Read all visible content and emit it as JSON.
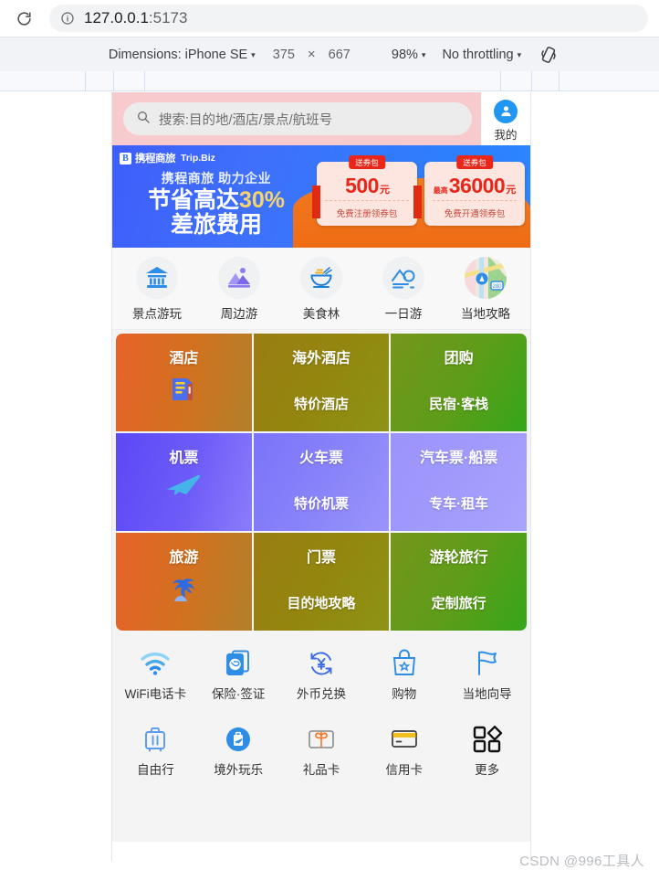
{
  "browser": {
    "reload_icon": "reload-icon",
    "info_icon": "info-icon",
    "url_host": "127.0.0.1",
    "url_port": ":5173"
  },
  "device_toolbar": {
    "dimensions_label": "Dimensions: iPhone SE",
    "width": "375",
    "times": "×",
    "height": "667",
    "zoom": "98%",
    "throttling": "No throttling",
    "rotate_icon": "rotate-device-icon",
    "caret": "▾"
  },
  "app": {
    "search": {
      "icon": "search-icon",
      "placeholder": "搜索:目的地/酒店/景点/航班号"
    },
    "mine": {
      "icon": "user-avatar-icon",
      "label": "我的"
    },
    "banner": {
      "logo_mark": "B",
      "logo_cn": "携程商旅",
      "logo_en": "Trip.Biz",
      "subtitle": "携程商旅 助力企业",
      "line1_a": "节省高达",
      "line1_b": "30%",
      "line2": "差旅费用",
      "coupons": [
        {
          "badge": "送券包",
          "prefix": "",
          "amount": "500",
          "unit": "元",
          "note": "免费注册领券包"
        },
        {
          "badge": "送券包",
          "prefix": "最高",
          "amount": "36000",
          "unit": "元",
          "note": "免费开通领券包"
        }
      ]
    },
    "quick_items": [
      {
        "icon": "temple-icon",
        "label": "景点游玩"
      },
      {
        "icon": "mountain-icon",
        "label": "周边游"
      },
      {
        "icon": "noodle-bowl-icon",
        "label": "美食林"
      },
      {
        "icon": "landscape-icon",
        "label": "一日游"
      },
      {
        "icon": "map-navigation-icon",
        "label": "当地攻略"
      }
    ],
    "grid": [
      {
        "main": "酒店",
        "sub": "",
        "icon": "hotel-building-icon",
        "color_from": "#e8622a",
        "color_to": "#b2802b"
      },
      {
        "main": "海外酒店",
        "sub": "特价酒店",
        "icon": "",
        "color_from": "#9a7d12",
        "color_to": "#8c9416"
      },
      {
        "main": "团购",
        "sub": "民宿·客栈",
        "icon": "",
        "color_from": "#76951b",
        "color_to": "#35a61a"
      },
      {
        "main": "机票",
        "sub": "",
        "icon": "airplane-icon",
        "color_from": "#5a49f5",
        "color_to": "#8a7dfb"
      },
      {
        "main": "火车票",
        "sub": "特价机票",
        "icon": "",
        "color_from": "#7b73f9",
        "color_to": "#9a95fb"
      },
      {
        "main": "汽车票·船票",
        "sub": "专车·租车",
        "icon": "",
        "color_from": "#9a94fb",
        "color_to": "#a9a4fc"
      },
      {
        "main": "旅游",
        "sub": "",
        "icon": "palm-tree-icon",
        "color_from": "#e8622a",
        "color_to": "#b2802b"
      },
      {
        "main": "门票",
        "sub": "目的地攻略",
        "icon": "",
        "color_from": "#9a7d12",
        "color_to": "#8c9416"
      },
      {
        "main": "游轮旅行",
        "sub": "定制旅行",
        "icon": "",
        "color_from": "#76951b",
        "color_to": "#35a61a"
      }
    ],
    "services_row1": [
      {
        "icon": "wifi-icon",
        "label": "WiFi电话卡"
      },
      {
        "icon": "passport-visa-icon",
        "label": "保险·签证"
      },
      {
        "icon": "currency-exchange-icon",
        "label": "外币兑换"
      },
      {
        "icon": "shopping-bag-icon",
        "label": "购物"
      },
      {
        "icon": "flag-icon",
        "label": "当地向导"
      }
    ],
    "services_row2": [
      {
        "icon": "suitcase-icon",
        "label": "自由行"
      },
      {
        "icon": "overseas-play-icon",
        "label": "境外玩乐"
      },
      {
        "icon": "gift-card-icon",
        "label": "礼品卡"
      },
      {
        "icon": "credit-card-icon",
        "label": "信用卡"
      },
      {
        "icon": "more-grid-icon",
        "label": "更多"
      }
    ]
  },
  "watermark": "CSDN @996工具人"
}
